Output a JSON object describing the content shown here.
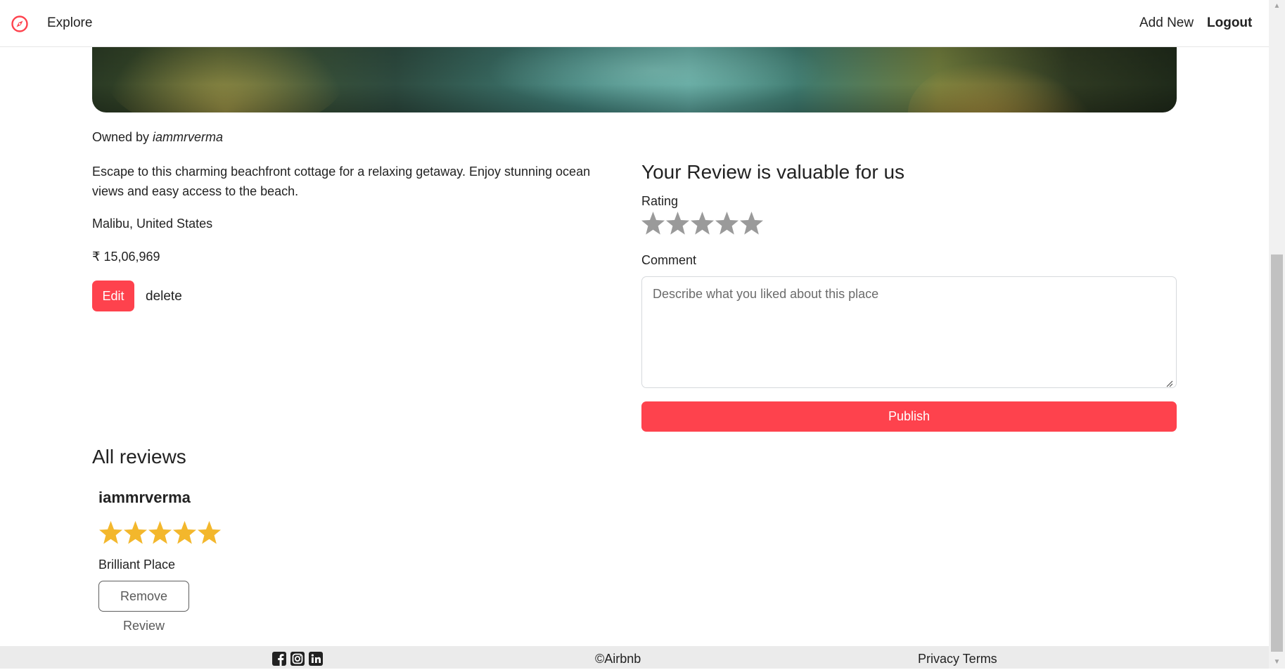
{
  "navbar": {
    "brand_icon": "compass-icon",
    "explore_label": "Explore",
    "add_new_label": "Add New",
    "logout_label": "Logout"
  },
  "listing": {
    "owned_by_prefix": "Owned by ",
    "owner": "iammrverma",
    "description": "Escape to this charming beachfront cottage for a relaxing getaway. Enjoy stunning ocean views and easy access to the beach.",
    "location": "Malibu, United States",
    "price": "₹ 15,06,969",
    "edit_label": "Edit",
    "delete_label": "delete"
  },
  "review_form": {
    "heading": "Your Review is valuable for us",
    "rating_label": "Rating",
    "rating_max": 5,
    "rating_selected": 0,
    "comment_label": "Comment",
    "comment_placeholder": "Describe what you liked about this place",
    "publish_label": "Publish"
  },
  "reviews": {
    "heading": "All reviews",
    "items": [
      {
        "author": "iammrverma",
        "rating": 5,
        "comment": "Brilliant Place",
        "remove_label": "Remove Review"
      }
    ]
  },
  "footer": {
    "social_icons": [
      "facebook-icon",
      "instagram-icon",
      "linkedin-icon"
    ],
    "copyright": "©Airbnb",
    "privacy_terms": "Privacy Terms"
  },
  "colors": {
    "accent": "#fe424d",
    "star_filled": "#f3b72c",
    "star_empty": "#9a9a9a",
    "footer_bg": "#ebebeb"
  }
}
